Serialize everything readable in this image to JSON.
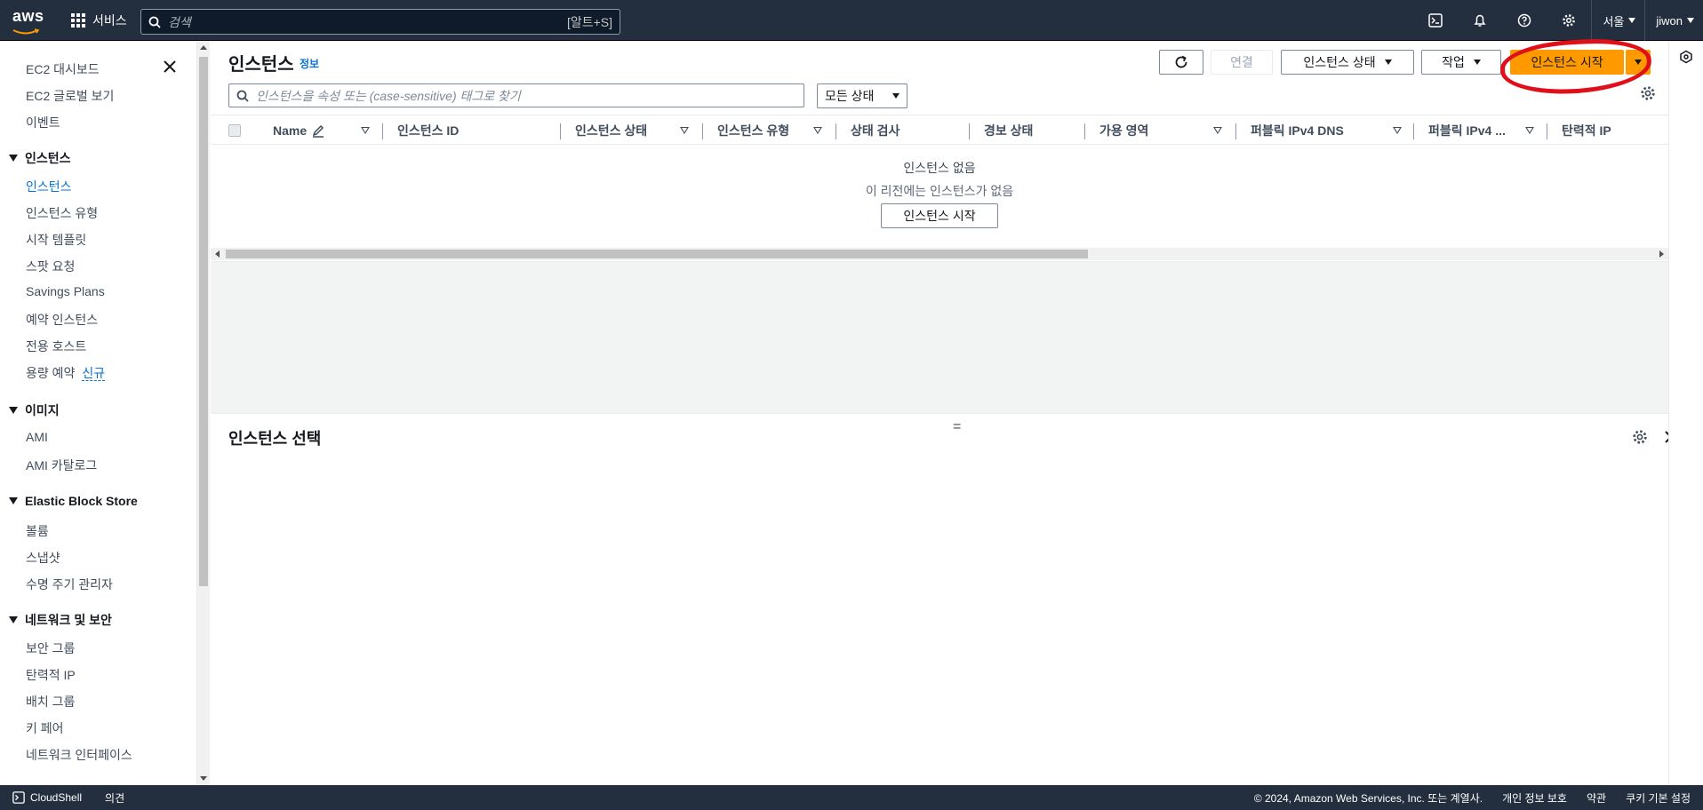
{
  "topnav": {
    "logo_text": "aws",
    "services_label": "서비스",
    "search_placeholder": "검색",
    "search_shortcut": "[알트+S]",
    "region_label": "서울",
    "user_label": "jiwon"
  },
  "sidebar": {
    "items_top": [
      "EC2 대시보드",
      "EC2 글로벌 보기",
      "이벤트"
    ],
    "sections": [
      {
        "title": "인스턴스",
        "items": [
          "인스턴스",
          "인스턴스 유형",
          "시작 템플릿",
          "스팟 요청",
          "Savings Plans",
          "예약 인스턴스",
          "전용 호스트",
          "용량 예약"
        ]
      },
      {
        "title": "이미지",
        "items": [
          "AMI",
          "AMI 카탈로그"
        ]
      },
      {
        "title": "Elastic Block Store",
        "items": [
          "볼륨",
          "스냅샷",
          "수명 주기 관리자"
        ]
      },
      {
        "title": "네트워크 및 보안",
        "items": [
          "보안 그룹",
          "탄력적 IP",
          "배치 그룹",
          "키 페어",
          "네트워크 인터페이스"
        ]
      }
    ],
    "new_badge": "신규"
  },
  "main": {
    "title": "인스턴스",
    "info_link": "정보",
    "connect_label": "연결",
    "instance_state_label": "인스턴스 상태",
    "actions_label": "작업",
    "launch_label": "인스턴스 시작",
    "filter_placeholder": "인스턴스을 속성 또는 (case-sensitive) 태그로 찾기",
    "state_filter": "모든 상태",
    "columns": [
      "Name",
      "인스턴스 ID",
      "인스턴스 상태",
      "인스턴스 유형",
      "상태 검사",
      "경보 상태",
      "가용 영역",
      "퍼블릭 IPv4 DNS",
      "퍼블릭 IPv4 ...",
      "탄력적 IP"
    ],
    "empty_title": "인스턴스 없음",
    "empty_sub": "이 리전에는 인스턴스가 없음",
    "empty_button": "인스턴스 시작"
  },
  "split": {
    "title": "인스턴스 선택",
    "handle": "="
  },
  "footer": {
    "cloudshell": "CloudShell",
    "feedback": "의견",
    "copyright": "© 2024, Amazon Web Services, Inc. 또는 계열사.",
    "privacy": "개인 정보 보호",
    "terms": "약관",
    "cookies": "쿠키 기본 설정"
  },
  "colors": {
    "nav_bg": "#232f3e",
    "primary": "#ff9900",
    "link": "#0972d3",
    "annotation": "#e0101a"
  }
}
